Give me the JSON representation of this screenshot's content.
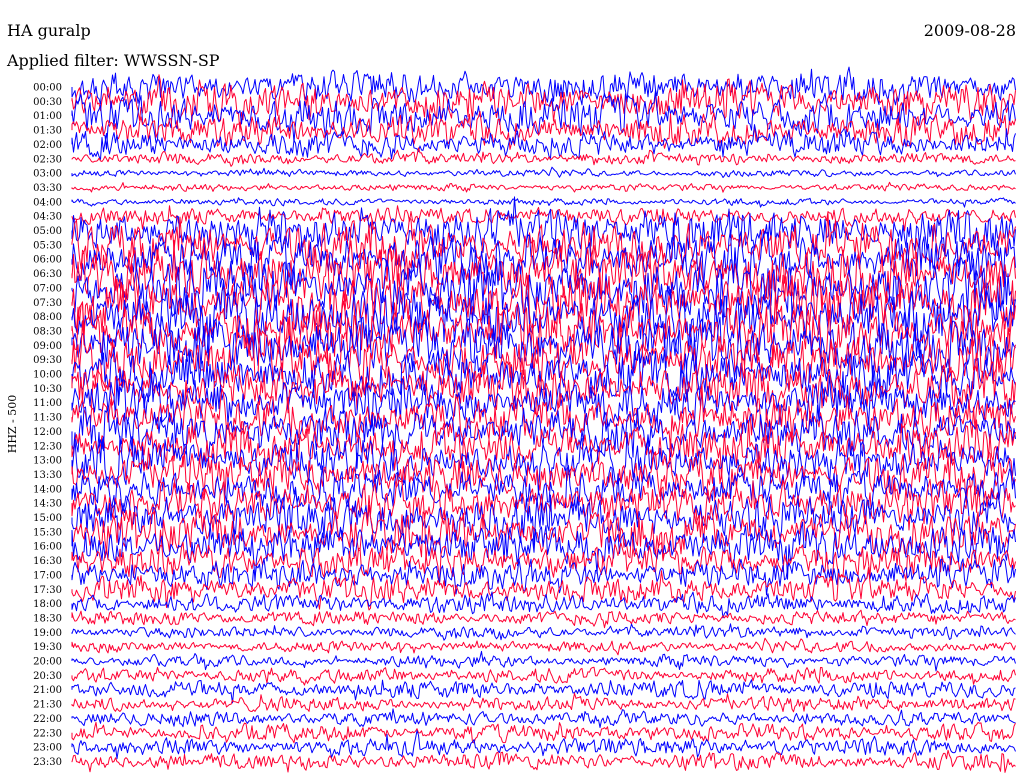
{
  "header": {
    "station": "HA guralp",
    "date": "2009-08-28",
    "filter": "Applied filter: WWSSN-SP"
  },
  "colors": {
    "trace_a": "#0000ff",
    "trace_b": "#ff0033",
    "background": "#ffffff",
    "text": "#000000"
  },
  "chart_data": {
    "type": "line",
    "title": "HA guralp",
    "subtitle": "Applied filter: WWSSN-SP",
    "ylabel": "HHZ - 500",
    "xlabel": "",
    "row_interval_minutes": 30,
    "row_labels": [
      "00:00",
      "00:30",
      "01:00",
      "01:30",
      "02:00",
      "02:30",
      "03:00",
      "03:30",
      "04:00",
      "04:30",
      "05:00",
      "05:30",
      "06:00",
      "06:30",
      "07:00",
      "07:30",
      "08:00",
      "08:30",
      "09:00",
      "09:30",
      "10:00",
      "10:30",
      "11:00",
      "11:30",
      "12:00",
      "12:30",
      "13:00",
      "13:30",
      "14:00",
      "14:30",
      "15:00",
      "15:30",
      "16:00",
      "16:30",
      "17:00",
      "17:30",
      "18:00",
      "18:30",
      "19:00",
      "19:30",
      "20:00",
      "20:30",
      "21:00",
      "21:30",
      "22:00",
      "22:30",
      "23:00",
      "23:30"
    ],
    "trace_colors": [
      "#0000ff",
      "#ff0033"
    ],
    "relative_amplitude": [
      0.55,
      0.65,
      0.65,
      0.55,
      0.45,
      0.2,
      0.12,
      0.12,
      0.12,
      0.3,
      0.75,
      0.8,
      0.85,
      0.95,
      1.0,
      1.0,
      1.0,
      0.95,
      0.95,
      0.9,
      0.85,
      0.8,
      0.75,
      0.75,
      0.75,
      0.75,
      0.75,
      0.7,
      0.7,
      0.7,
      0.75,
      0.75,
      0.7,
      0.6,
      0.5,
      0.45,
      0.35,
      0.25,
      0.2,
      0.2,
      0.2,
      0.25,
      0.3,
      0.25,
      0.25,
      0.3,
      0.3,
      0.3
    ],
    "grid": false,
    "legend": "none"
  }
}
